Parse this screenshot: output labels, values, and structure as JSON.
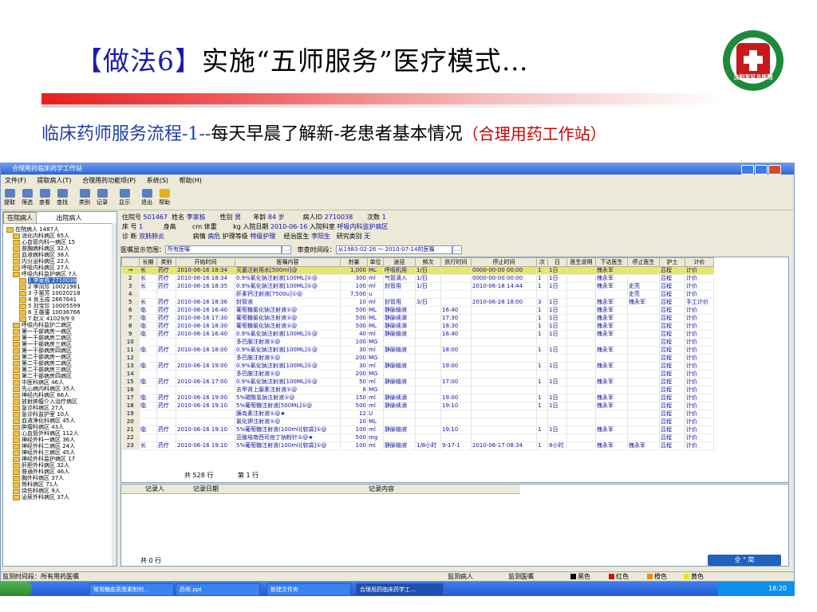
{
  "slide": {
    "title_open": "【",
    "title_method": "做法6",
    "title_close": "】",
    "title_main": "实施“五师服务”医疗模式…",
    "subtitle_a": "临床药师服务流程-1--",
    "subtitle_b": "每天早晨了解新-老患者基本情况",
    "subtitle_c": "（合理用药工作站）",
    "logo_text": "沈阳军区总医院"
  },
  "window": {
    "title": "合理用药临床药学工作站",
    "menu": [
      "文件(F)",
      "提取病人(T)",
      "合理用药功能项(P)",
      "系统(S)",
      "帮助(H)"
    ],
    "toolbar": [
      "提取",
      "筛选",
      "查看",
      "查找",
      "类别",
      "记录",
      "显示",
      "退出",
      "帮助"
    ]
  },
  "tree": {
    "tab_in": "在院病人",
    "tab_out": "出院病人",
    "items": [
      {
        "label": "在院病人  1487人",
        "lvl": 0
      },
      {
        "label": "消化内科病区  65人",
        "lvl": 1
      },
      {
        "label": "心血管内科一病区  15",
        "lvl": 1
      },
      {
        "label": "普胸病科病区  32人",
        "lvl": 1
      },
      {
        "label": "血液病科病区  38人",
        "lvl": 1
      },
      {
        "label": "内分泌科病区  22人",
        "lvl": 1
      },
      {
        "label": "呼吸内科病区  27人",
        "lvl": 1
      },
      {
        "label": "呼吸内科监护病区  7人",
        "lvl": 1
      },
      {
        "label": "1 李家栋  2710038",
        "lvl": 2,
        "sel": true
      },
      {
        "label": "2 李凤珍  10021981",
        "lvl": 2
      },
      {
        "label": "3 于振芳  10020218",
        "lvl": 2
      },
      {
        "label": "4 肖玉成  2667641",
        "lvl": 2
      },
      {
        "label": "5 刘宝珍  10005599",
        "lvl": 2
      },
      {
        "label": "6 王雄蓬  10036766",
        "lvl": 2
      },
      {
        "label": "7 赵义  41029/9  0",
        "lvl": 2
      },
      {
        "label": "呼吸内科监护二病区",
        "lvl": 1
      },
      {
        "label": "第一干部病房一病区",
        "lvl": 1
      },
      {
        "label": "第一干部病房二病区",
        "lvl": 1
      },
      {
        "label": "第一干部病房三病区",
        "lvl": 1
      },
      {
        "label": "第一干部病房四病区",
        "lvl": 1
      },
      {
        "label": "第二干部病房一病区",
        "lvl": 1
      },
      {
        "label": "第二干部病房二病区",
        "lvl": 1
      },
      {
        "label": "第二干部病房三病区",
        "lvl": 1
      },
      {
        "label": "第二干部病房四病区",
        "lvl": 1
      },
      {
        "label": "中医科病区  46人",
        "lvl": 1
      },
      {
        "label": "先心病内科病区  35人",
        "lvl": 1
      },
      {
        "label": "神经内科病区  66人",
        "lvl": 1
      },
      {
        "label": "放射肿瘤介入治疗病区",
        "lvl": 1
      },
      {
        "label": "急诊科病区  27人",
        "lvl": 1
      },
      {
        "label": "急诊科监护室  10人",
        "lvl": 1
      },
      {
        "label": "血液净化科病区  45人",
        "lvl": 1
      },
      {
        "label": "肿瘤科病区  43人",
        "lvl": 1
      },
      {
        "label": "心血管外科病区  112人",
        "lvl": 1
      },
      {
        "label": "神经外科一病区  36人",
        "lvl": 1
      },
      {
        "label": "神经外科二病区  24人",
        "lvl": 1
      },
      {
        "label": "神经外科三病区  45人",
        "lvl": 1
      },
      {
        "label": "神经外科监护病区  17",
        "lvl": 1
      },
      {
        "label": "肝胆外科病区  32人",
        "lvl": 1
      },
      {
        "label": "普通外科病区  46人",
        "lvl": 1
      },
      {
        "label": "胸外科病区  37人",
        "lvl": 1
      },
      {
        "label": "骨科病区  71人",
        "lvl": 1
      },
      {
        "label": "烧伤科病区  9人",
        "lvl": 1
      },
      {
        "label": "泌尿外科病区  37人",
        "lvl": 1
      }
    ]
  },
  "patient": {
    "l_hosp": "住院号",
    "v_hosp": "501467",
    "l_name": "姓名",
    "v_name": "李家栋",
    "l_sex": "性别",
    "v_sex": "男",
    "l_age": "年龄",
    "v_age": "84 岁",
    "l_pid": "病人ID",
    "v_pid": "2710038",
    "l_times": "次数",
    "v_times": "1",
    "l_bed": "床  号",
    "v_bed": "1",
    "l_height": "身高",
    "v_height": "cm",
    "l_weight": "体重",
    "v_weight": "kg",
    "l_admit": "入院日期",
    "v_admit": "2010-06-16",
    "l_dept": "入院科室",
    "v_dept": "呼吸内科监护病区",
    "l_diag": "诊  断",
    "v_diag": "双肺肺炎",
    "l_cond": "病情",
    "v_cond": "病危",
    "l_care": "护理等级",
    "v_care": "特级护理",
    "l_doc": "经治医生",
    "v_doc": "李阳生",
    "l_research": "研究类别",
    "v_research": "无"
  },
  "filter": {
    "scope_label": "医嘱显示范围：",
    "scope_value": "所有医嘱",
    "time_label": "审查时间段：",
    "time_value": "从1983-02-26 ～ 2010-07-14的医嘱"
  },
  "grid": {
    "headers": [
      "",
      "长期",
      "类别",
      "开始时间",
      "医嘱内容",
      "剂量",
      "单位",
      "途径",
      "频次",
      "执行时间",
      "停止时间",
      "次",
      "日",
      "医生说明",
      "下达医生",
      "停止医生",
      "护士",
      "计价"
    ],
    "rows": [
      [
        "→",
        "长",
        "药疗",
        "2010-06-16 18:34",
        "灭菌注射用水[500ml]@",
        "1,000",
        "ML",
        "呼吸机用",
        "1/日",
        "",
        "0000-00-00 00:00",
        "1",
        "1日",
        "",
        "槐永军",
        "",
        "吕程",
        "计价"
      ],
      [
        "2",
        "长",
        "药疗",
        "2010-06-16 18:34",
        "0.9%氯化钠注射液[100ML]①@",
        "300",
        "ml",
        "气管滴入",
        "1/日",
        "",
        "0000-00-00 00:00",
        "1",
        "1日",
        "",
        "槐永军",
        "",
        "吕程",
        "计价"
      ],
      [
        "3",
        "长",
        "药疗",
        "2010-06-16 18:35",
        "0.9%氯化钠注射液[100ML]①@",
        "100",
        "ml",
        "封管用",
        "1/日",
        "",
        "2010-06-18 14:44",
        "1",
        "1日",
        "",
        "槐永军",
        "史亮",
        "吕程",
        "计价"
      ],
      [
        "4",
        "",
        "",
        "",
        "肝素钙注射液[7500u]①@",
        "7,500",
        "u",
        "",
        "",
        "",
        "",
        "",
        "",
        "",
        "",
        "史亮",
        "吕程",
        "计价"
      ],
      [
        "5",
        "长",
        "药疗",
        "2010-06-16 18:36",
        "封管液",
        "10",
        "ml",
        "封管用",
        "3/日",
        "",
        "2010-06-28 18:00",
        "3",
        "1日",
        "",
        "槐永军",
        "槐永军",
        "吕程",
        "手工计价"
      ],
      [
        "6",
        "临",
        "药疗",
        "2010-06-16 16:40",
        "葡萄糖氯化钠注射液①@",
        "500",
        "ML",
        "静脉输液",
        "",
        "16:40",
        "",
        "1",
        "1日",
        "",
        "槐永军",
        "",
        "吕程",
        "计价"
      ],
      [
        "7",
        "临",
        "药疗",
        "2010-06-16 17:30",
        "葡萄糖氯化钠注射液①@",
        "500",
        "ML",
        "静脉续滴",
        "",
        "17:30",
        "",
        "1",
        "1日",
        "",
        "槐永军",
        "",
        "吕程",
        "计价"
      ],
      [
        "8",
        "临",
        "药疗",
        "2010-06-16 18:30",
        "葡萄糖氯化钠注射液①@",
        "500",
        "ML",
        "静脉续滴",
        "",
        "18:30",
        "",
        "1",
        "1日",
        "",
        "槐永军",
        "",
        "吕程",
        "计价"
      ],
      [
        "9",
        "临",
        "药疗",
        "2010-06-16 16:40",
        "0.9%氯化钠注射液[100ML]①@",
        "40",
        "ml",
        "静脉输液",
        "",
        "16:40",
        "",
        "1",
        "1日",
        "",
        "槐永军",
        "",
        "吕程",
        "计价"
      ],
      [
        "10",
        "",
        "",
        "",
        "多巴胺注射液①@",
        "100",
        "MG",
        "",
        "",
        "",
        "",
        "",
        "",
        "",
        "",
        "",
        "吕程",
        "计价"
      ],
      [
        "11",
        "临",
        "药疗",
        "2010-06-16 18:00",
        "0.9%氯化钠注射液[100ML]①@",
        "30",
        "ml",
        "静脉输液",
        "",
        "18:00",
        "",
        "1",
        "1日",
        "",
        "槐永军",
        "",
        "吕程",
        "计价"
      ],
      [
        "12",
        "",
        "",
        "",
        "多巴胺注射液①@",
        "200",
        "MG",
        "",
        "",
        "",
        "",
        "",
        "",
        "",
        "",
        "",
        "吕程",
        "计价"
      ],
      [
        "13",
        "临",
        "药疗",
        "2010-06-16 19:00",
        "0.9%氯化钠注射液[100ML]①@",
        "30",
        "ml",
        "静脉输液",
        "",
        "19:00",
        "",
        "1",
        "1日",
        "",
        "槐永军",
        "",
        "吕程",
        "计价"
      ],
      [
        "14",
        "",
        "",
        "",
        "多巴胺注射液①@",
        "200",
        "MG",
        "",
        "",
        "",
        "",
        "",
        "",
        "",
        "",
        "",
        "吕程",
        "计价"
      ],
      [
        "15",
        "临",
        "药疗",
        "2010-06-16 17:00",
        "0.9%氯化钠注射液[100ML]①@",
        "50",
        "ml",
        "静脉输液",
        "",
        "17:00",
        "",
        "1",
        "1日",
        "",
        "槐永军",
        "",
        "吕程",
        "计价"
      ],
      [
        "16",
        "",
        "",
        "",
        "去甲肾上腺素注射液①@",
        "8",
        "MG",
        "",
        "",
        "",
        "",
        "",
        "",
        "",
        "",
        "",
        "吕程",
        "计价"
      ],
      [
        "17",
        "临",
        "药疗",
        "2010-06-16 19:00",
        "5%碳酸氢钠注射液①@",
        "150",
        "ml",
        "静脉续滴",
        "",
        "19:00",
        "",
        "1",
        "1日",
        "",
        "槐永军",
        "",
        "吕程",
        "计价"
      ],
      [
        "18",
        "临",
        "药疗",
        "2010-06-16 19:10",
        "5%葡萄糖注射液[500ML]①@",
        "500",
        "ml",
        "静脉续滴",
        "",
        "19:10",
        "",
        "1",
        "1日",
        "",
        "槐永军",
        "",
        "吕程",
        "计价"
      ],
      [
        "19",
        "",
        "",
        "",
        "胰岛素注射液①@★",
        "12",
        "U",
        "",
        "",
        "",
        "",
        "",
        "",
        "",
        "",
        "",
        "吕程",
        "计价"
      ],
      [
        "20",
        "",
        "",
        "",
        "氯化钾注射液①@",
        "10",
        "ML",
        "",
        "",
        "",
        "",
        "",
        "",
        "",
        "",
        "",
        "吕程",
        "计价"
      ],
      [
        "21",
        "临",
        "药疗",
        "2010-06-16 19:10",
        "5%葡萄糖注射液(100ml)[软袋]①@",
        "100",
        "ml",
        "静脉输液",
        "",
        "19:10",
        "",
        "1",
        "1日",
        "",
        "槐永军",
        "",
        "吕程",
        "计价"
      ],
      [
        "22",
        "",
        "",
        "",
        "亚胺培南西司他丁钠粉针①@★",
        "500",
        "mg",
        "",
        "",
        "",
        "",
        "",
        "",
        "",
        "",
        "",
        "吕程",
        "计价"
      ],
      [
        "23",
        "长",
        "药疗",
        "2010-06-16 19:10",
        "5%葡萄糖注射液(100ml)[软袋]①@",
        "100",
        "ml",
        "静脉输液",
        "1/8小时",
        "9-17-1",
        "2010-06-17 08:34",
        "1",
        "8小时",
        "",
        "槐永军",
        "槐永军",
        "吕程",
        "计价"
      ]
    ],
    "total": "共 528 行",
    "page": "第 1 行"
  },
  "records": {
    "h1": "记录人",
    "h2": "记录日期",
    "h3": "记录内容",
    "total": "共 0 行"
  },
  "ime": "全 ° 简",
  "status": {
    "left": "监测时间段：所有用药医嘱",
    "mid1": "监测病人",
    "mid2": "监测医嘱",
    "black": "黑色",
    "red": "红色",
    "orange": "橙色",
    "yellow": "黄色"
  },
  "taskbar": {
    "tasks": [
      "常用糖皮质激素制剂…",
      "药师.ppt",
      "新建文件夹",
      "合理用药临床药学工…"
    ],
    "time": "18:20"
  },
  "colors": {
    "accent": "#1d8a3a",
    "highlight": "#e6e668",
    "title_blue": "#1f3fa8",
    "title_red": "#cc0000"
  }
}
